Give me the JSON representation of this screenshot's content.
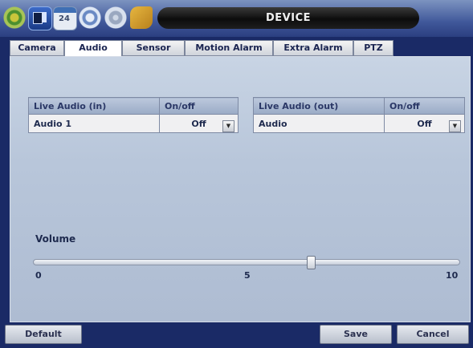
{
  "window": {
    "title": "DEVICE"
  },
  "toolbar_icons": [
    "system-gear-icon",
    "display-icon",
    "schedule-calendar-icon",
    "network-icon",
    "disk-icon",
    "tools-icon"
  ],
  "toolbar": {
    "calendar_day": "24"
  },
  "tabs": [
    {
      "label": "Camera",
      "active": false
    },
    {
      "label": "Audio",
      "active": true
    },
    {
      "label": "Sensor",
      "active": false
    },
    {
      "label": "Motion Alarm",
      "active": false
    },
    {
      "label": "Extra Alarm",
      "active": false
    },
    {
      "label": "PTZ",
      "active": false
    }
  ],
  "audio_in": {
    "headers": [
      "Live Audio (in)",
      "On/off"
    ],
    "rows": [
      {
        "name": "Audio 1",
        "value": "Off"
      }
    ]
  },
  "audio_out": {
    "headers": [
      "Live Audio (out)",
      "On/off"
    ],
    "rows": [
      {
        "name": "Audio",
        "value": "Off"
      }
    ]
  },
  "volume": {
    "label": "Volume",
    "min_label": "0",
    "mid_label": "5",
    "max_label": "10",
    "value": 6.5
  },
  "buttons": {
    "default": "Default",
    "save": "Save",
    "cancel": "Cancel"
  }
}
